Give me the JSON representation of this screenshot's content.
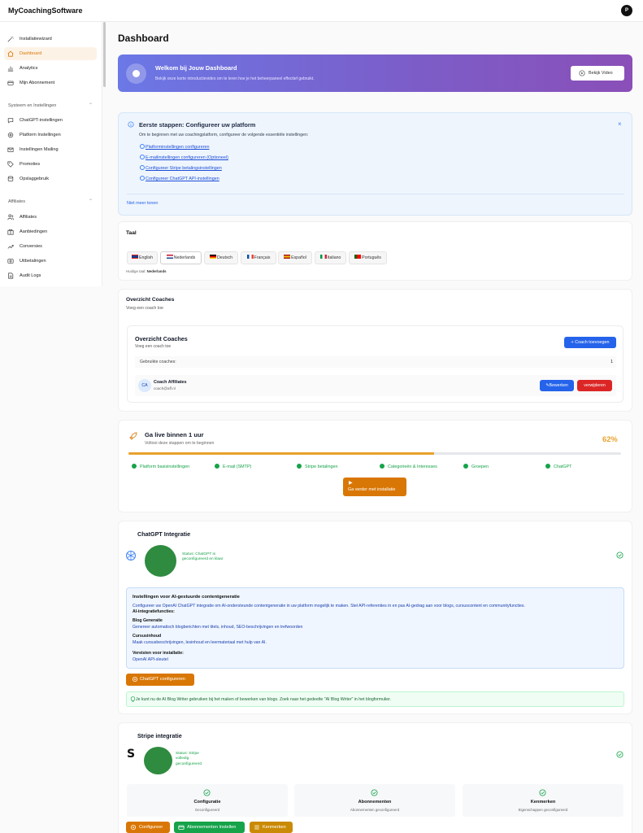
{
  "app": {
    "brand": "MyCoachingSoftware",
    "user_initial": "P"
  },
  "sidebar": {
    "items": [
      {
        "label": "Installatiewizard",
        "icon": "wand-icon"
      },
      {
        "label": "Dashboard",
        "icon": "home-icon",
        "active": true
      },
      {
        "label": "Analytics",
        "icon": "bar-chart-icon"
      },
      {
        "label": "Mijn Abonnement",
        "icon": "card-icon"
      }
    ],
    "section_system": "Systeem en Instellingen",
    "system_items": [
      {
        "label": "ChatGPT-instellingen",
        "icon": "chat-icon"
      },
      {
        "label": "Platform Instellingen",
        "icon": "gear-icon"
      },
      {
        "label": "Instellingen Mailing",
        "icon": "mail-icon"
      },
      {
        "label": "Promoties",
        "icon": "tag-icon"
      },
      {
        "label": "Opslaggebruik",
        "icon": "database-icon"
      }
    ],
    "section_affiliates": "Affiliates",
    "affiliate_items": [
      {
        "label": "Affiliates",
        "icon": "users-icon"
      },
      {
        "label": "Aanbiedingen",
        "icon": "offer-icon"
      },
      {
        "label": "Conversies",
        "icon": "trend-icon"
      },
      {
        "label": "Uitbetalingen",
        "icon": "payout-icon"
      },
      {
        "label": "Audit Logs",
        "icon": "log-icon"
      }
    ]
  },
  "main": {
    "title": "Dashboard",
    "welcome": {
      "title": "Welkom bij Jouw Dashboard",
      "subtitle": "Bekijk onze korte introductievideo om te leren hoe je het beheerpaneel effectief gebruikt.",
      "button": "Bekijk Video"
    },
    "first_steps": {
      "title": "Eerste stappen: Configureer uw platform",
      "intro": "Om te beginnen met uw coachingplatform, configureer de volgende essentiële instellingen:",
      "links": [
        "Platforminstellingen configureren",
        "E-mailinstellingen configureren (Optioneel)",
        "Configureer Stripe betalingsinstellingen",
        "Configureer ChatGPT API-instellingen"
      ],
      "close": "×",
      "dismiss": "Niet meer tonen"
    },
    "language": {
      "title": "Taal",
      "options": [
        {
          "label": "English",
          "flag": "gb"
        },
        {
          "label": "Nederlands",
          "flag": "nl",
          "active": true
        },
        {
          "label": "Deutsch",
          "flag": "de"
        },
        {
          "label": "Français",
          "flag": "fr"
        },
        {
          "label": "Español",
          "flag": "es"
        },
        {
          "label": "Italiano",
          "flag": "it"
        },
        {
          "label": "Português",
          "flag": "pt"
        }
      ],
      "current_label": "Huidige taal:",
      "current_value": "Nederlands"
    },
    "coaches": {
      "title": "Overzicht Coaches",
      "subtitle": "Voeg een coach toe",
      "inner_title": "Overzicht Coaches",
      "inner_subtitle": "Voeg een coach toe",
      "add_button": "+ Coach toevoegen",
      "used_label": "Gebruikte coaches:",
      "used_value": "1",
      "rows": [
        {
          "initials": "CA",
          "name": "Coach Affiliates",
          "email": "coach@aff.nl",
          "edit": "Bewerken",
          "delete": "verwijderen"
        }
      ]
    },
    "golive": {
      "title": "Ga live binnen 1 uur",
      "subtitle": "Voltooi deze stappen om te beginnen",
      "percent_label": "62%",
      "progress": 0.62,
      "steps": [
        "Platform basisinstellingen",
        "E-mail (SMTP)",
        "Stripe betalingen",
        "Categorieën & Interesses",
        "Groepen",
        "ChatGPT"
      ],
      "button": "Ga verder met installatie"
    },
    "chatgpt": {
      "title": "ChatGPT Integratie",
      "status": "Status: ChatGPT is geconfigureerd en klaar",
      "box_title": "Instellingen voor AI-gestuurde contentgeneratie",
      "box_text": "Configureer uw OpenAI ChatGPT integratie om AI-ondersteunde contentgeneratie in uw platform mogelijk te maken. Stel API-referenties in en pas AI-gedrag aan voor blogs, cursuscontent en communityfuncties.",
      "features_label": "AI-integratiefuncties:",
      "blog_label": "Blog Generatie",
      "blog_text": "Genereer automatisch blogberichten met titels, inhoud, SEO-beschrijvingen en trefwoorden",
      "course_label": "Cursusinhoud",
      "course_text": "Maak cursusbeschrijvingen, lesinhoud en leermateriaal met hulp van AI.",
      "req_label": "Vereisten voor installatie:",
      "req_text": "OpenAI API-sleutel",
      "config_button": "ChatGPT configureren",
      "tip": "Je kunt nu de AI Blog Writer gebruiken bij het maken of bewerken van blogs. Zoek naar het gedeelte \"AI Blog Writer\" in het blogformulier."
    },
    "stripe": {
      "title": "Stripe integratie",
      "logo": "S",
      "status": "Status: Stripe volledig geconfigureerd",
      "features": [
        {
          "title": "Configuratie",
          "sub": "Geconfigureerd"
        },
        {
          "title": "Abonnementen",
          "sub": "Abonnementen geconfigureerd"
        },
        {
          "title": "Kenmerken",
          "sub": "Eigenschappen geconfigureerd"
        }
      ],
      "buttons": [
        {
          "label": "Configureer",
          "color": "#d97706"
        },
        {
          "label": "Abonnementen Instellen",
          "color": "#16a34a"
        },
        {
          "label": "Kenmerken",
          "color": "#ca8a04"
        }
      ]
    }
  },
  "colors": {
    "accent": "#d97706",
    "primary": "#2563eb",
    "danger": "#dc2626",
    "success": "#16a34a",
    "progress": "#e9a22c"
  }
}
